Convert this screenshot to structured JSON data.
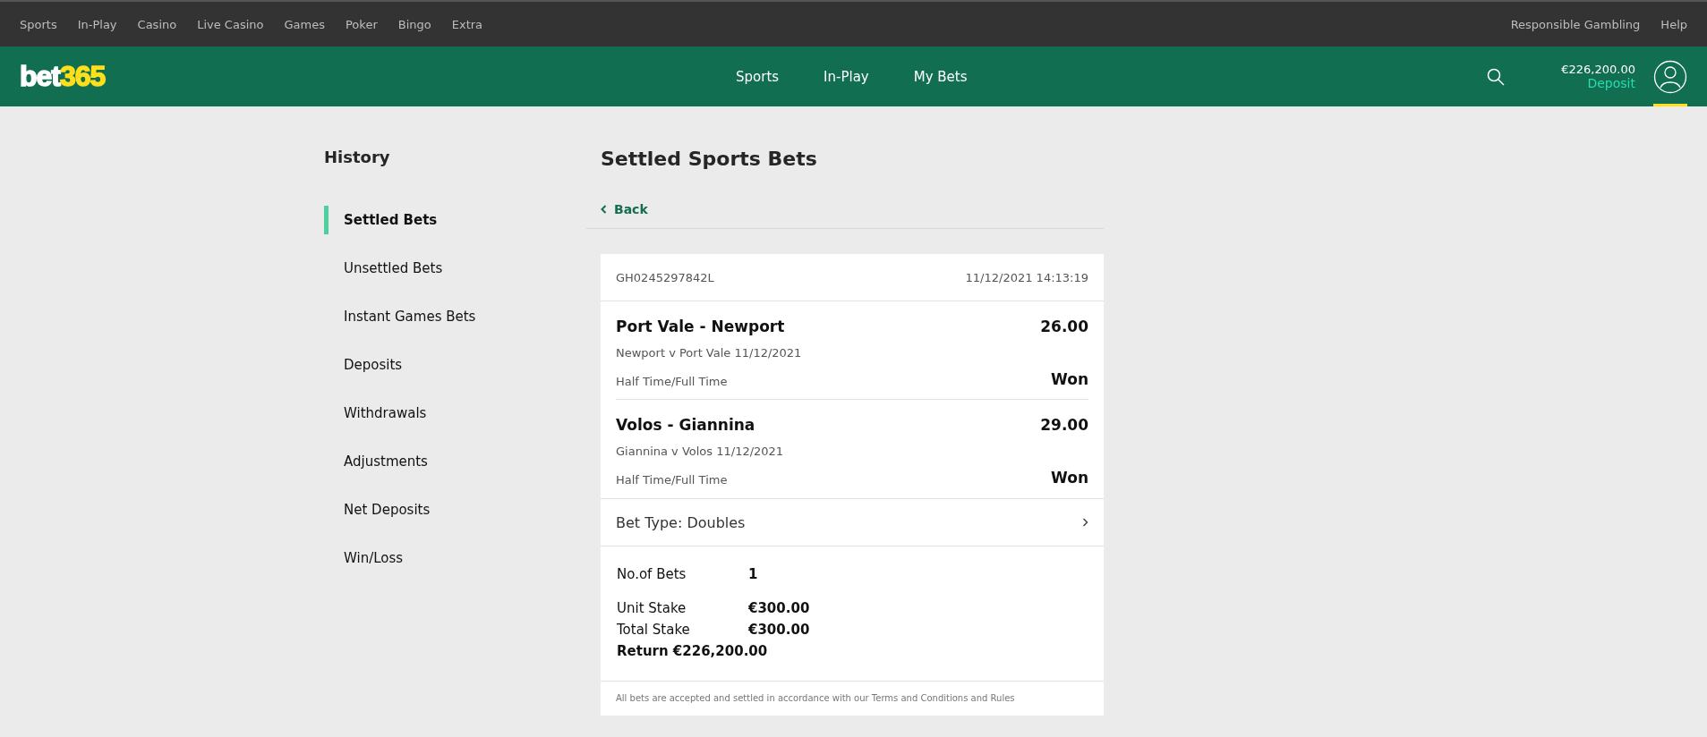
{
  "top_nav": {
    "left": [
      "Sports",
      "In-Play",
      "Casino",
      "Live Casino",
      "Games",
      "Poker",
      "Bingo",
      "Extra"
    ],
    "right": [
      "Responsible Gambling",
      "Help"
    ]
  },
  "header": {
    "logo": {
      "main": "bet",
      "accent": "365"
    },
    "nav": [
      "Sports",
      "In-Play",
      "My Bets"
    ],
    "balance": "€226,200.00",
    "deposit": "Deposit"
  },
  "sidebar": {
    "title": "History",
    "items": [
      {
        "label": "Settled Bets",
        "selected": true
      },
      {
        "label": "Unsettled Bets",
        "selected": false
      },
      {
        "label": "Instant Games Bets",
        "selected": false
      },
      {
        "label": "Deposits",
        "selected": false
      },
      {
        "label": "Withdrawals",
        "selected": false
      },
      {
        "label": "Adjustments",
        "selected": false
      },
      {
        "label": "Net Deposits",
        "selected": false
      },
      {
        "label": "Win/Loss",
        "selected": false
      }
    ]
  },
  "main": {
    "title": "Settled Sports Bets",
    "back": "Back",
    "bet": {
      "reference": "GH0245297842L",
      "datetime": "11/12/2021 14:13:19",
      "selections": [
        {
          "name": "Port Vale - Newport",
          "odds": "26.00",
          "event": "Newport v Port Vale 11/12/2021",
          "market": "Half Time/Full Time",
          "result": "Won"
        },
        {
          "name": "Volos - Giannina",
          "odds": "29.00",
          "event": "Giannina v Volos 11/12/2021",
          "market": "Half Time/Full Time",
          "result": "Won"
        }
      ],
      "bet_type": "Bet Type: Doubles",
      "summary": [
        {
          "label": "No.of Bets",
          "value": "1"
        },
        {
          "label": "Unit Stake",
          "value": "€300.00"
        },
        {
          "label": "Total Stake",
          "value": "€300.00"
        }
      ],
      "return": "Return €226,200.00",
      "footer": "All bets are accepted and settled in accordance with our Terms and Conditions and Rules"
    }
  }
}
